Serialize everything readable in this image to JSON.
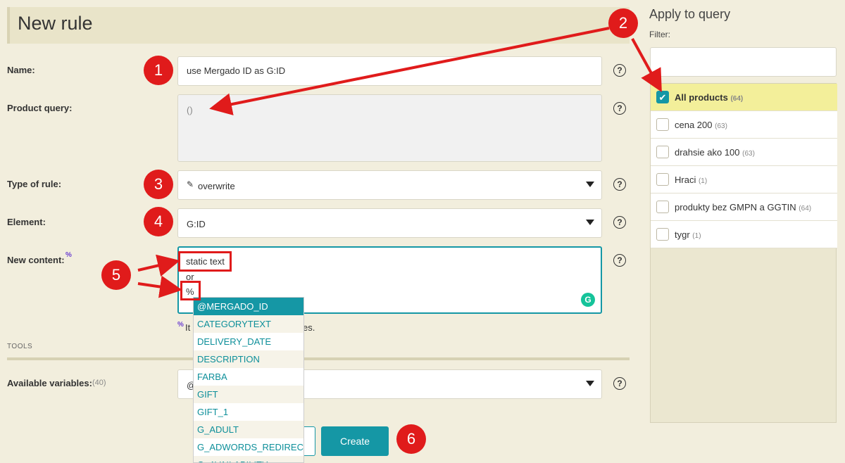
{
  "page_title": "New rule",
  "form": {
    "name_label": "Name:",
    "name_value": "use Mergado ID as G:ID",
    "query_label": "Product query:",
    "query_value": "()",
    "type_label": "Type of rule:",
    "type_value": "overwrite",
    "element_label": "Element:",
    "element_value": "G:ID",
    "content_label": "New content:",
    "content_marker": "%",
    "content_line1": "static text",
    "content_line2": "or",
    "content_line3": "%",
    "hint_prefix": "%",
    "hint_start": "It",
    "hint_end": "es.",
    "help_glyph": "?"
  },
  "tools": {
    "heading": "TOOLS",
    "vars_label": "Available variables:",
    "vars_count": "(40)",
    "vars_value": "@"
  },
  "autocomplete": {
    "items": [
      "@MERGADO_ID",
      "CATEGORYTEXT",
      "DELIVERY_DATE",
      "DESCRIPTION",
      "FARBA",
      "GIFT",
      "GIFT_1",
      "G_ADULT",
      "G_ADWORDS_REDIRECT",
      "G_AVAILABILITY"
    ]
  },
  "buttons": {
    "create": "Create"
  },
  "sidebar": {
    "title": "Apply to query",
    "filter_label": "Filter:",
    "filter_value": "",
    "queries": [
      {
        "label": "All products",
        "count": "(64)",
        "checked": true
      },
      {
        "label": "cena 200",
        "count": "(63)",
        "checked": false
      },
      {
        "label": "drahsie ako 100",
        "count": "(63)",
        "checked": false
      },
      {
        "label": "Hraci",
        "count": "(1)",
        "checked": false
      },
      {
        "label": "produkty bez GMPN a GGTIN",
        "count": "(64)",
        "checked": false
      },
      {
        "label": "tygr",
        "count": "(1)",
        "checked": false
      }
    ]
  },
  "callouts": [
    "1",
    "2",
    "3",
    "4",
    "5",
    "6"
  ],
  "colors": {
    "accent": "#1597a5",
    "callout": "#e01b1b",
    "highlight": "#f3ef9a",
    "background": "#f2eedd"
  },
  "icons": {
    "type_icon": "pencil-icon",
    "checkbox": "check-icon",
    "grammarly": "grammarly-icon"
  }
}
